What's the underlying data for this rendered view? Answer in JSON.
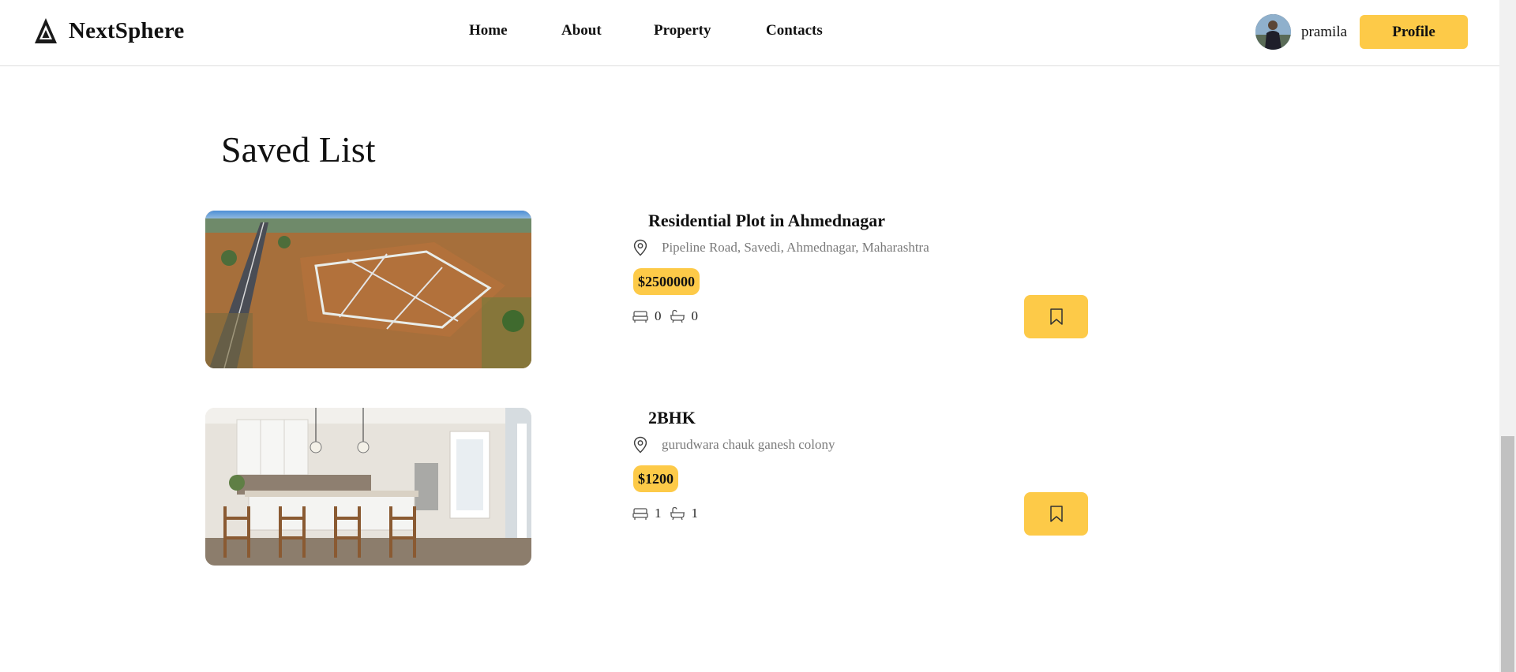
{
  "header": {
    "brand": "NextSphere",
    "nav": [
      {
        "label": "Home"
      },
      {
        "label": "About"
      },
      {
        "label": "Property"
      },
      {
        "label": "Contacts"
      }
    ],
    "user": {
      "name": "pramila"
    },
    "profile_label": "Profile"
  },
  "main": {
    "title": "Saved List",
    "listings": [
      {
        "title": "Residential Plot in Ahmednagar",
        "location": "Pipeline Road, Savedi, Ahmednagar, Maharashtra",
        "price": "$2500000",
        "beds": "0",
        "baths": "0",
        "image": "aerial-plot-photo"
      },
      {
        "title": "2BHK",
        "location": "gurudwara chauk ganesh colony",
        "price": "$1200",
        "beds": "1",
        "baths": "1",
        "image": "kitchen-interior-photo"
      }
    ]
  },
  "theme": {
    "accent": "#fdca48",
    "muted_text": "#7a7a7a",
    "divider": "#dedede"
  },
  "icons": {
    "location": "map-pin-icon",
    "beds": "bed-icon",
    "baths": "bathtub-icon",
    "save": "bookmark-icon"
  }
}
